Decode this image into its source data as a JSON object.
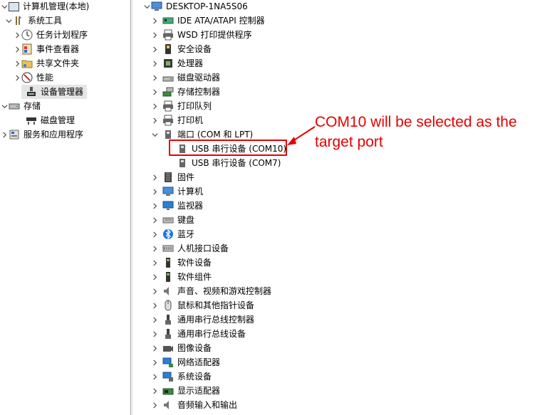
{
  "left_tree": {
    "items": [
      {
        "label": "计算机管理(本地)",
        "icon": "computer-management-icon",
        "expander": "down"
      },
      {
        "label": "系统工具",
        "icon": "tools-icon",
        "expander": "down"
      },
      {
        "label": "任务计划程序",
        "icon": "clock-icon",
        "expander": "right"
      },
      {
        "label": "事件查看器",
        "icon": "event-viewer-icon",
        "expander": "right"
      },
      {
        "label": "共享文件夹",
        "icon": "shared-folder-icon",
        "expander": "right"
      },
      {
        "label": "性能",
        "icon": "performance-icon",
        "expander": "right"
      },
      {
        "label": "设备管理器",
        "icon": "device-manager-icon",
        "expander": "none",
        "selected": true
      },
      {
        "label": "存储",
        "icon": "storage-icon",
        "expander": "down"
      },
      {
        "label": "磁盘管理",
        "icon": "disk-management-icon",
        "expander": "none"
      },
      {
        "label": "服务和应用程序",
        "icon": "services-icon",
        "expander": "right"
      }
    ]
  },
  "device_tree": {
    "root": {
      "label": "DESKTOP-1NA5S06",
      "icon": "computer-icon"
    },
    "categories": [
      {
        "label": "IDE ATA/ATAPI 控制器",
        "icon": "ide-controller-icon"
      },
      {
        "label": "WSD 打印提供程序",
        "icon": "printer-icon"
      },
      {
        "label": "安全设备",
        "icon": "security-device-icon"
      },
      {
        "label": "处理器",
        "icon": "processor-icon"
      },
      {
        "label": "磁盘驱动器",
        "icon": "disk-drive-icon"
      },
      {
        "label": "存储控制器",
        "icon": "storage-controller-icon"
      },
      {
        "label": "打印队列",
        "icon": "print-queue-icon"
      },
      {
        "label": "打印机",
        "icon": "printer-icon"
      },
      {
        "label": "端口 (COM 和 LPT)",
        "icon": "port-icon",
        "expanded": true,
        "children": [
          {
            "label": "USB 串行设备 (COM10)",
            "icon": "serial-port-icon"
          },
          {
            "label": "USB 串行设备 (COM7)",
            "icon": "serial-port-icon"
          }
        ]
      },
      {
        "label": "固件",
        "icon": "firmware-icon"
      },
      {
        "label": "计算机",
        "icon": "computer-icon"
      },
      {
        "label": "监视器",
        "icon": "monitor-icon"
      },
      {
        "label": "键盘",
        "icon": "keyboard-icon"
      },
      {
        "label": "蓝牙",
        "icon": "bluetooth-icon"
      },
      {
        "label": "人机接口设备",
        "icon": "hid-icon"
      },
      {
        "label": "软件设备",
        "icon": "software-device-icon"
      },
      {
        "label": "软件组件",
        "icon": "software-component-icon"
      },
      {
        "label": "声音、视频和游戏控制器",
        "icon": "audio-icon"
      },
      {
        "label": "鼠标和其他指针设备",
        "icon": "mouse-icon"
      },
      {
        "label": "通用串行总线控制器",
        "icon": "usb-controller-icon"
      },
      {
        "label": "通用串行总线设备",
        "icon": "usb-device-icon"
      },
      {
        "label": "图像设备",
        "icon": "camera-icon"
      },
      {
        "label": "网络适配器",
        "icon": "network-adapter-icon"
      },
      {
        "label": "系统设备",
        "icon": "system-device-icon"
      },
      {
        "label": "显示适配器",
        "icon": "display-adapter-icon"
      },
      {
        "label": "音频输入和输出",
        "icon": "audio-io-icon"
      }
    ]
  },
  "annotation": {
    "text": "COM10 will be selected as the target port",
    "color": "#e60000"
  }
}
